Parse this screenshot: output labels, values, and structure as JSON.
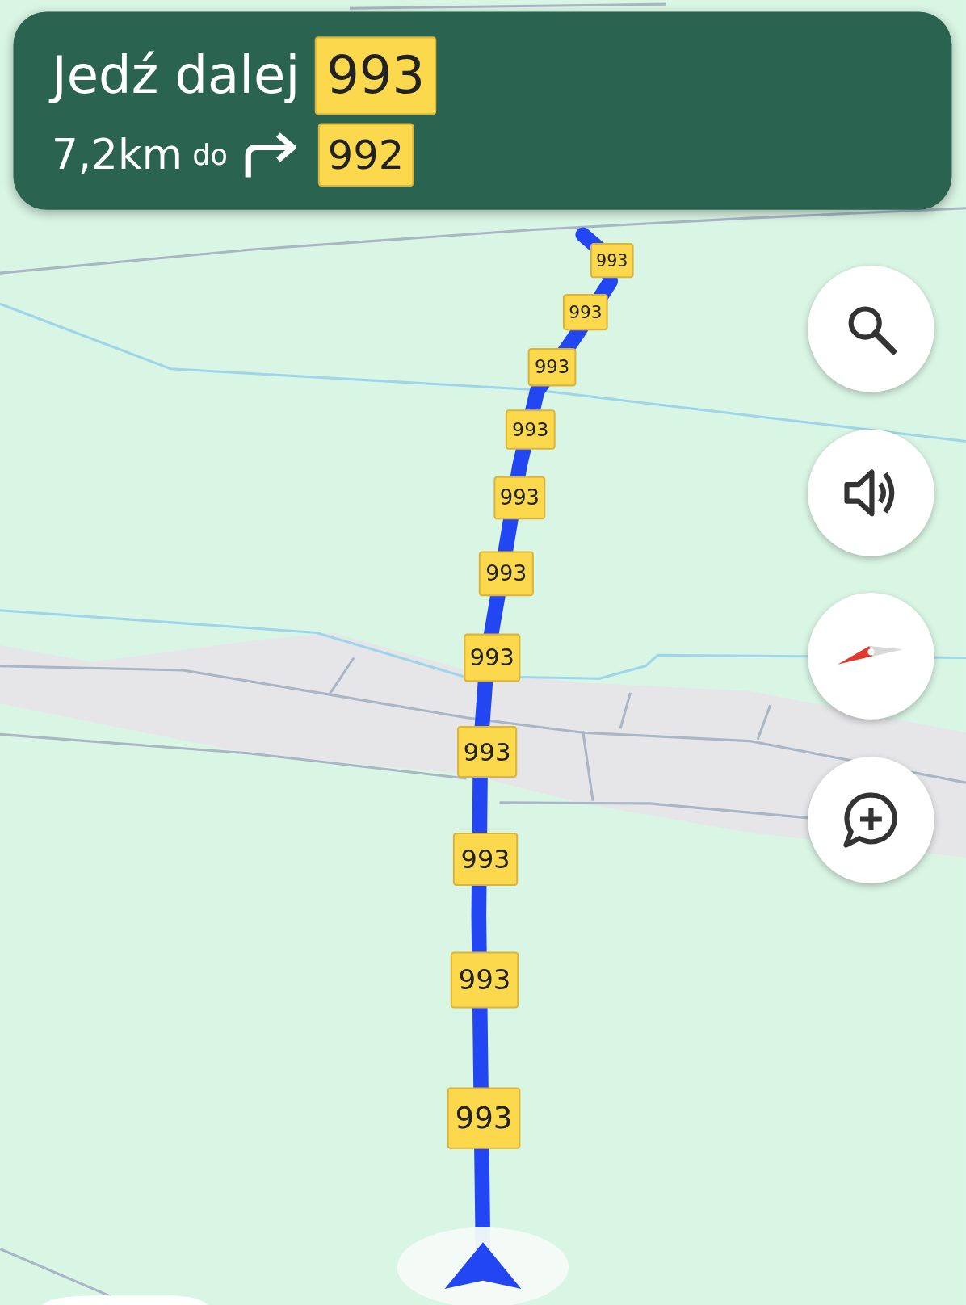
{
  "instruction": {
    "action": "Jedź dalej",
    "road": "993"
  },
  "next": {
    "distance": "7,2km",
    "connector": "do",
    "kind": "turn_right",
    "road": "992"
  },
  "route_shields": [
    "993",
    "993",
    "993",
    "993",
    "993",
    "993",
    "993",
    "993",
    "993",
    "993",
    "993"
  ],
  "map_buttons": [
    {
      "kind": "search"
    },
    {
      "kind": "sound"
    },
    {
      "kind": "compass"
    },
    {
      "kind": "report"
    }
  ]
}
